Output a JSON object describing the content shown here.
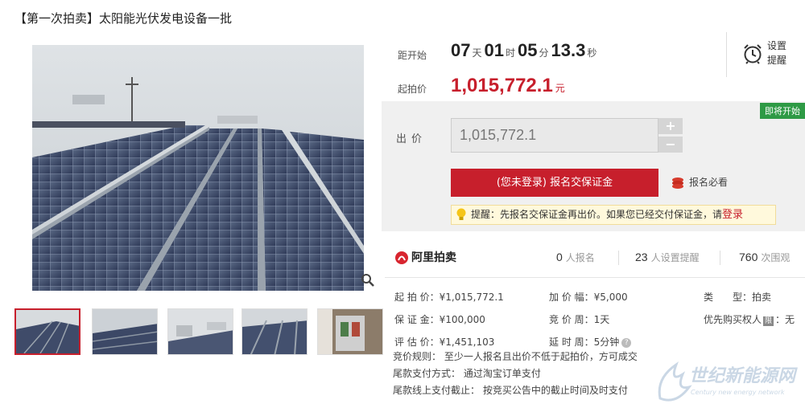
{
  "page": {
    "title": "【第一次拍卖】太阳能光伏发电设备一批"
  },
  "gallery": {
    "thumb_count": 5,
    "zoom_icon": "magnifier-icon"
  },
  "countdown": {
    "label": "距开始",
    "days": "07",
    "days_unit": "天",
    "hours": "01",
    "hours_unit": "时",
    "minutes": "05",
    "minutes_unit": "分",
    "seconds": "13.3",
    "seconds_unit": "秒"
  },
  "reminder": {
    "line1": "设置",
    "line2": "提醒",
    "icon": "alarm-clock-icon"
  },
  "start_price": {
    "label": "起拍价",
    "value": "1,015,772.1",
    "unit": "元"
  },
  "bid": {
    "badge": "即将开始",
    "label": "出价",
    "input_value": "1,015,772.1",
    "plus": "+",
    "minus": "−",
    "register_button": "(您未登录) 报名交保证金",
    "must_see": "报名必看",
    "tip_text": "提醒：先报名交保证金再出价。如果您已经交付保证金，请",
    "tip_link": "登录"
  },
  "stats": {
    "brand": "阿里拍卖",
    "registered_count": "0",
    "registered_label": "人报名",
    "reminder_count": "23",
    "reminder_label": "人设置提醒",
    "watch_count": "760",
    "watch_label": "次围观"
  },
  "details": {
    "col1": [
      {
        "key": "起 拍 价：",
        "value": "¥1,015,772.1"
      },
      {
        "key": "保 证 金：",
        "value": "¥100,000"
      },
      {
        "key": "评 估 价：",
        "value": "¥1,451,103"
      }
    ],
    "col2": [
      {
        "key": "加 价 幅：",
        "value": "¥5,000"
      },
      {
        "key": "竞 价 周：",
        "value": "1天"
      },
      {
        "key": "延 时 周：",
        "value": "5分钟"
      }
    ],
    "col3": [
      {
        "key": "类　　型：",
        "value": "拍卖"
      },
      {
        "key": "优先购买权人",
        "badge": "限",
        "value": "：无"
      }
    ]
  },
  "rules": {
    "line1": "竞价规则：  至少一人报名且出价不低于起拍价，方可成交",
    "line2": "尾款支付方式：  通过淘宝订单支付",
    "line3": "尾款线上支付截止：  按竞买公告中的截止时间及时支付"
  },
  "watermark": {
    "cn": "世纪新能源网",
    "en": "Century new energy network"
  },
  "colors": {
    "accent_red": "#c71f2c",
    "badge_green": "#2e9a45",
    "panel_gray": "#f0f0f0",
    "tip_yellow": "#fff9dc"
  }
}
